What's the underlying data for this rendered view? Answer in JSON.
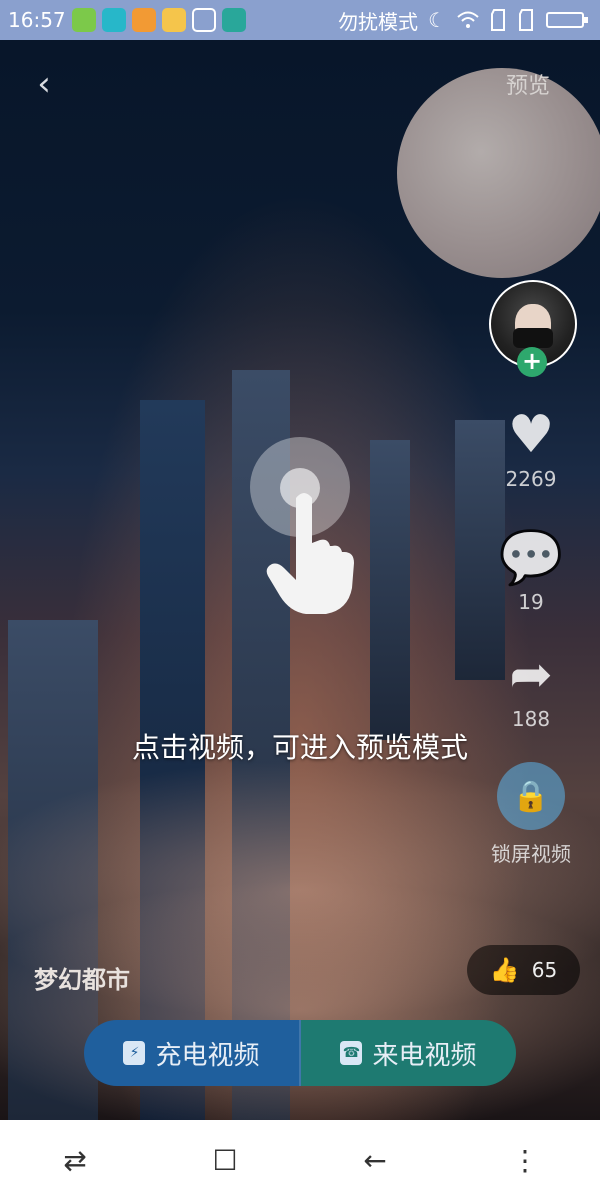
{
  "status_bar": {
    "time": "16:57",
    "dnd_label": "勿扰模式",
    "icons": [
      "store-icon",
      "app-icon",
      "warning-icon",
      "folder-icon",
      "brush-icon",
      "usb-icon",
      "moon-icon",
      "wifi-icon",
      "sim1-icon",
      "sim2-icon",
      "battery-icon"
    ]
  },
  "header": {
    "back_icon": "‹",
    "preview_label": "预览"
  },
  "side_rail": {
    "likes_count": "2269",
    "comments_count": "19",
    "shares_count": "188",
    "lock_label": "锁屏视频"
  },
  "hint": {
    "text": "点击视频，可进入预览模式"
  },
  "video": {
    "title": "梦幻都市",
    "thumbs_up_count": "65"
  },
  "actions": {
    "charge_video_label": "充电视频",
    "incoming_call_video_label": "来电视频"
  },
  "colors": {
    "status_bar_bg": "#8aa0ce",
    "charge_button": "#1f5f9d",
    "incoming_button": "#1e7a71",
    "follow_plus": "#2ea86d"
  }
}
